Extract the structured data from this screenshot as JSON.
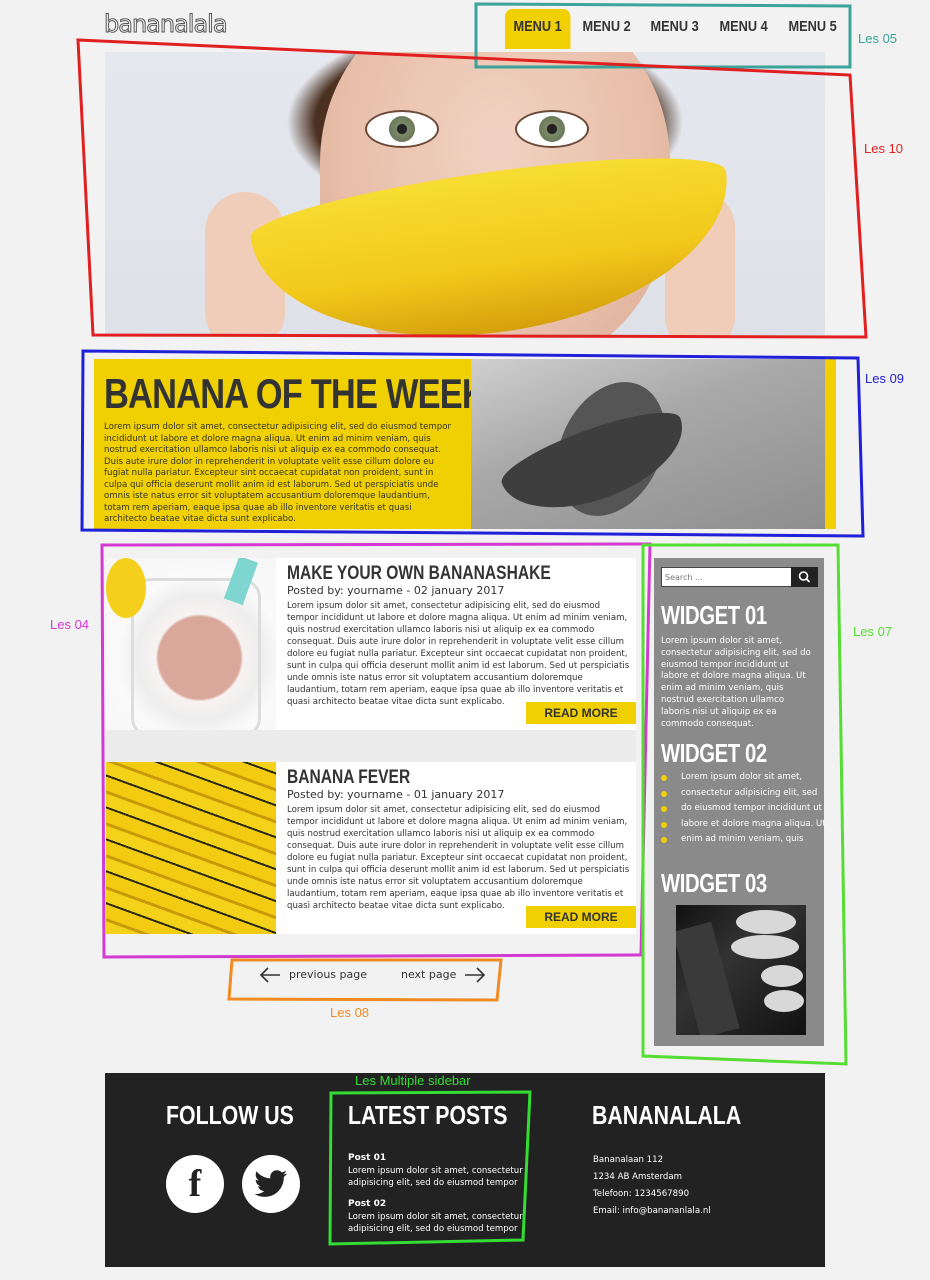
{
  "logo": "bananalala",
  "nav": {
    "items": [
      "MENU 1",
      "MENU 2",
      "MENU 3",
      "MENU 4",
      "MENU 5"
    ],
    "active_index": 0
  },
  "banana_of_week": {
    "title": "BANANA OF THE WEEK",
    "text": "Lorem ipsum dolor sit amet, consectetur adipisicing elit, sed do eiusmod tempor incididunt ut labore et dolore magna aliqua. Ut enim ad minim veniam, quis nostrud exercitation ullamco laboris nisi ut aliquip ex ea commodo consequat. Duis aute irure dolor in reprehenderit in voluptate velit esse cillum dolore eu fugiat nulla pariatur. Excepteur sint occaecat cupidatat non proident, sunt in culpa qui officia deserunt mollit anim id est laborum. Sed ut perspiciatis unde omnis iste natus error sit voluptatem accusantium doloremque laudantium, totam rem aperiam, eaque ipsa quae ab illo inventore veritatis et quasi architecto beatae vitae dicta sunt explicabo."
  },
  "posts": [
    {
      "title": "MAKE YOUR OWN BANANASHAKE",
      "meta": "Posted by: yourname - 02 january 2017",
      "text": "Lorem ipsum dolor sit amet, consectetur adipisicing elit, sed do eiusmod tempor incididunt ut labore et dolore magna aliqua. Ut enim ad minim veniam, quis nostrud exercitation ullamco laboris nisi ut aliquip ex ea commodo consequat. Duis aute irure dolor in reprehenderit in voluptate velit esse cillum dolore eu fugiat nulla pariatur. Excepteur sint occaecat cupidatat non proident, sunt in culpa qui officia deserunt mollit anim id est laborum. Sed ut perspiciatis unde omnis iste natus error sit voluptatem accusantium doloremque laudantium, totam rem aperiam, eaque ipsa quae ab illo inventore veritatis et quasi architecto beatae vitae dicta sunt explicabo.",
      "button": "READ MORE"
    },
    {
      "title": "BANANA FEVER",
      "meta": "Posted by: yourname - 01 january 2017",
      "text": "Lorem ipsum dolor sit amet, consectetur adipisicing elit, sed do eiusmod tempor incididunt ut labore et dolore magna aliqua. Ut enim ad minim veniam, quis nostrud exercitation ullamco laboris nisi ut aliquip ex ea commodo consequat. Duis aute irure dolor in reprehenderit in voluptate velit esse cillum dolore eu fugiat nulla pariatur. Excepteur sint occaecat cupidatat non proident, sunt in culpa qui officia deserunt mollit anim id est laborum. Sed ut perspiciatis unde omnis iste natus error sit voluptatem accusantium doloremque laudantium, totam rem aperiam, eaque ipsa quae ab illo inventore veritatis et quasi architecto beatae vitae dicta sunt explicabo.",
      "button": "READ MORE"
    }
  ],
  "pagination": {
    "prev": "previous page",
    "next": "next page"
  },
  "sidebar": {
    "search_placeholder": "Search ...",
    "widget1_title": "WIDGET 01",
    "widget1_text": "Lorem ipsum dolor sit amet, consectetur adipisicing elit, sed do eiusmod tempor incididunt ut labore et dolore magna aliqua. Ut enim ad minim veniam, quis nostrud exercitation ullamco laboris nisi ut aliquip ex ea commodo consequat.",
    "widget2_title": "WIDGET 02",
    "widget2_items": [
      "Lorem ipsum dolor sit amet,",
      "consectetur adipisicing elit, sed",
      "do eiusmod tempor incididunt ut",
      "labore et dolore magna aliqua. Ut",
      "enim ad minim veniam, quis"
    ],
    "widget3_title": "WIDGET 03"
  },
  "footer": {
    "follow_title": "FOLLOW US",
    "latest_title": "LATEST POSTS",
    "latest_posts": [
      {
        "title": "Post 01",
        "text": "Lorem ipsum dolor sit amet, consectetur adipisicing elit, sed do eiusmod tempor"
      },
      {
        "title": "Post 02",
        "text": "Lorem ipsum dolor sit amet, consectetur adipisicing elit, sed do eiusmod tempor"
      }
    ],
    "brand_title": "BANANALALA",
    "contact": [
      "Bananalaan 112",
      "1234 AB Amsterdam",
      "Telefoon: 1234567890",
      "Email: info@banananlala.nl"
    ]
  },
  "annotations": {
    "les05": "Les 05",
    "les10": "Les 10",
    "les09": "Les 09",
    "les04": "Les 04",
    "les07": "Les 07",
    "les08": "Les 08",
    "multiple_sidebar": "Les Multiple sidebar"
  },
  "colors": {
    "accent": "#f0d000",
    "les05": "#3aa39a",
    "les10": "#e02020",
    "les09": "#2020d8",
    "les04": "#d23ad2",
    "les07": "#55dd33",
    "les08": "#f08a24",
    "multiple_sidebar": "#33dd33"
  }
}
